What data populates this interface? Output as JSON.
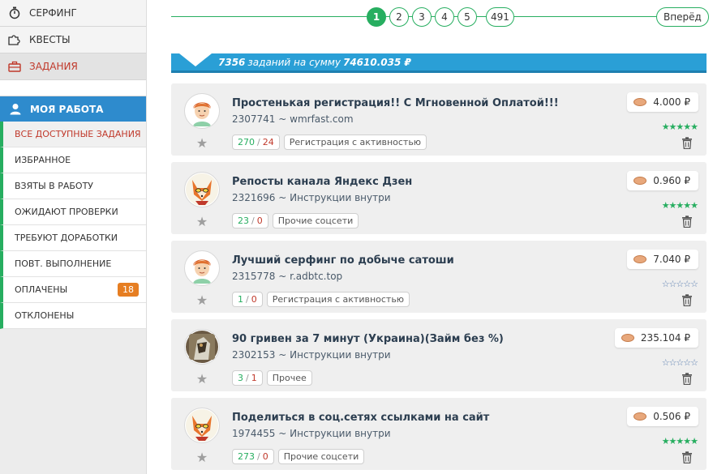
{
  "sidebar": {
    "top": [
      {
        "label": "СЕРФИНГ",
        "icon": "stopwatch-icon"
      },
      {
        "label": "КВЕСТЫ",
        "icon": "puzzle-icon"
      },
      {
        "label": "ЗАДАНИЯ",
        "icon": "briefcase-icon"
      }
    ],
    "section_label": "МОЯ РАБОТА",
    "section_icon": "user-icon",
    "items": [
      {
        "label": "ВСЕ ДОСТУПНЫЕ ЗАДАНИЯ"
      },
      {
        "label": "ИЗБРАННОЕ"
      },
      {
        "label": "ВЗЯТЫ В РАБОТУ"
      },
      {
        "label": "ОЖИДАЮТ ПРОВЕРКИ"
      },
      {
        "label": "ТРЕБУЮТ ДОРАБОТКИ"
      },
      {
        "label": "ПОВТ. ВЫПОЛНЕНИЕ"
      },
      {
        "label": "ОПЛАЧЕНЫ",
        "badge": "18"
      },
      {
        "label": "ОТКЛОНЕНЫ"
      }
    ]
  },
  "pagination": {
    "pages": [
      "1",
      "2",
      "3",
      "4",
      "5",
      "491"
    ],
    "current": "1",
    "next_label": "Вперёд"
  },
  "summary": {
    "count": "7356",
    "text_mid": "заданий на сумму",
    "amount": "74610.035 ₽"
  },
  "tasks": [
    {
      "title": "Простенькая регистрация!! С Мгновенной Оплатой!!!",
      "id": "2307741",
      "site": "wmrfast.com",
      "done": "270",
      "rejected": "24",
      "category": "Регистрация с активностью",
      "price": "4.000 ₽",
      "rating": "full",
      "avatar": "redhead-avatar"
    },
    {
      "title": "Репосты канала Яндекс Дзен",
      "id": "2321696",
      "site": "Инструкции внутри",
      "done": "23",
      "rejected": "0",
      "category": "Прочие соцсети",
      "price": "0.960 ₽",
      "rating": "full",
      "avatar": "fox-avatar"
    },
    {
      "title": "Лучший серфинг по добыче сатоши",
      "id": "2315778",
      "site": "r.adbtc.top",
      "done": "1",
      "rejected": "0",
      "category": "Регистрация с активностью",
      "price": "7.040 ₽",
      "rating": "empty",
      "avatar": "redhead-avatar"
    },
    {
      "title": "90 гривен за 7 минут (Украина)(Займ без %)",
      "id": "2302153",
      "site": "Инструкции внутри",
      "done": "3",
      "rejected": "1",
      "category": "Прочее",
      "price": "235.104 ₽",
      "rating": "empty",
      "avatar": "photo-avatar"
    },
    {
      "title": "Поделиться в соц.сетях ссылками на сайт",
      "id": "1974455",
      "site": "Инструкции внутри",
      "done": "273",
      "rejected": "0",
      "category": "Прочие соцсети",
      "price": "0.506 ₽",
      "rating": "full",
      "avatar": "fox-avatar"
    }
  ],
  "colors": {
    "accent_blue": "#2a9fd6",
    "green": "#27ae60",
    "red": "#c0392b",
    "badge": "#e67e22"
  }
}
